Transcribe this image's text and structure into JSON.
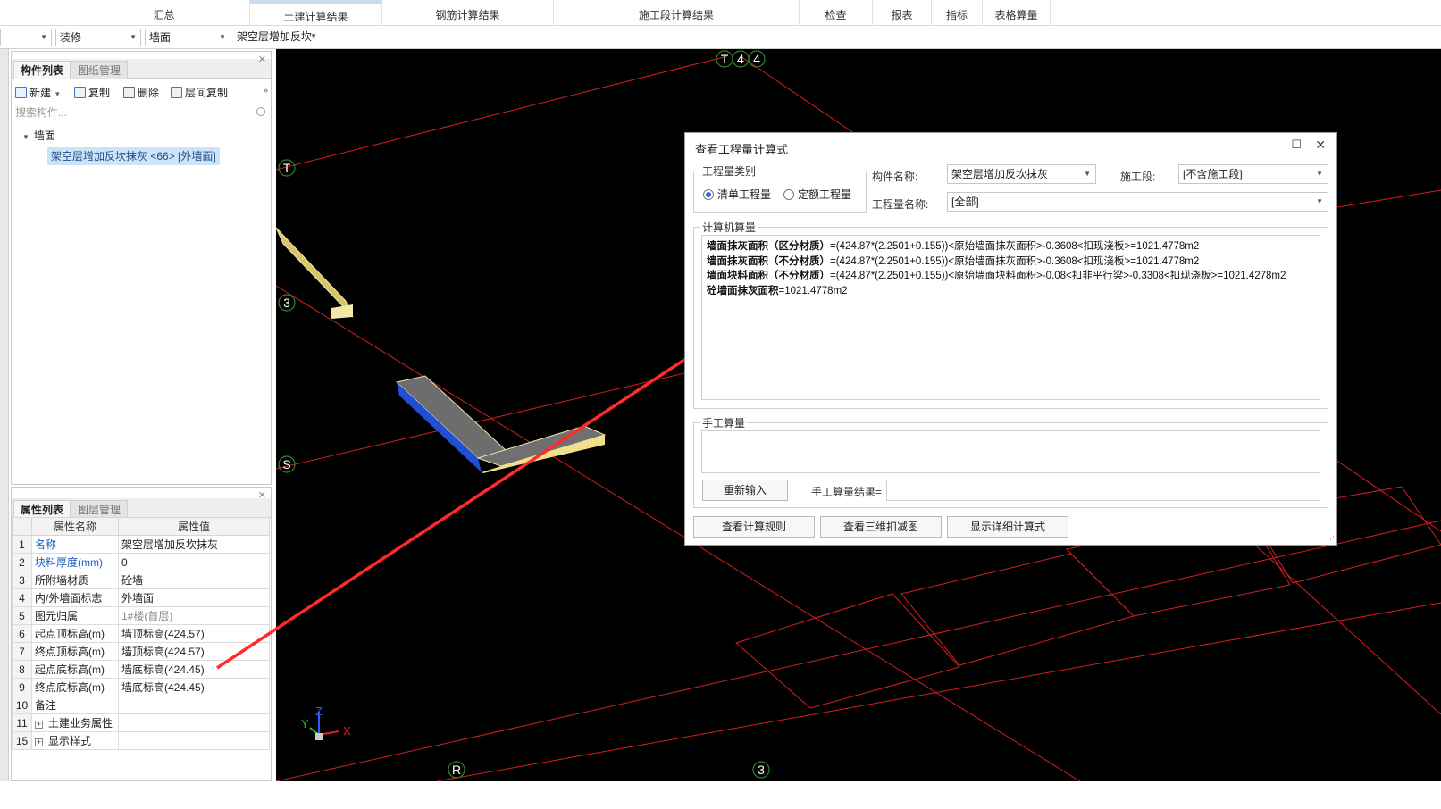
{
  "ribbon": {
    "tabs": [
      "汇总",
      "土建计算结果",
      "钢筋计算结果",
      "施工段计算结果",
      "检查",
      "报表",
      "指标",
      "表格算量"
    ]
  },
  "toolbar": {
    "combo_floor": "",
    "combo_category": "装修",
    "combo_type": "墙面",
    "combo_component": "架空层增加反坎"
  },
  "component_panel": {
    "tabs": [
      "构件列表",
      "图纸管理"
    ],
    "buttons": {
      "new": "新建",
      "copy": "复制",
      "delete": "删除",
      "floor_copy": "层间复制"
    },
    "search_placeholder": "搜索构件...",
    "tree_root": "墙面",
    "tree_item": "架空层增加反坎抹灰 <66> [外墙面]"
  },
  "property_panel": {
    "tabs": [
      "属性列表",
      "图层管理"
    ],
    "headers": {
      "name": "属性名称",
      "value": "属性值"
    },
    "rows": [
      {
        "num": "1",
        "name": "名称",
        "value": "架空层增加反坎抹灰"
      },
      {
        "num": "2",
        "name": "块料厚度(mm)",
        "value": "0"
      },
      {
        "num": "3",
        "name": "所附墙材质",
        "value": "砼墙"
      },
      {
        "num": "4",
        "name": "内/外墙面标志",
        "value": "外墙面"
      },
      {
        "num": "5",
        "name": "图元归属",
        "value": "1#楼(首层)"
      },
      {
        "num": "6",
        "name": "起点顶标高(m)",
        "value": "墙顶标高(424.57)"
      },
      {
        "num": "7",
        "name": "终点顶标高(m)",
        "value": "墙顶标高(424.57)"
      },
      {
        "num": "8",
        "name": "起点底标高(m)",
        "value": "墙底标高(424.45)"
      },
      {
        "num": "9",
        "name": "终点底标高(m)",
        "value": "墙底标高(424.45)"
      },
      {
        "num": "10",
        "name": "备注",
        "value": ""
      },
      {
        "num": "11",
        "name": "土建业务属性",
        "value": ""
      },
      {
        "num": "15",
        "name": "显示样式",
        "value": ""
      }
    ]
  },
  "viewport": {
    "axis_labels": {
      "t_top": "T",
      "four_a": "4",
      "four_b": "4",
      "t_left": "T",
      "three_left": "3",
      "s_left": "S",
      "r_bottom": "R",
      "three_bottom": "3"
    },
    "gizmo": {
      "x": "X",
      "y": "Y",
      "z": "Z"
    }
  },
  "dialog": {
    "title": "查看工程量计算式",
    "group_type": "工程量类别",
    "radio_list": "清单工程量",
    "radio_quota": "定额工程量",
    "component_name_label": "构件名称:",
    "component_name_value": "架空层增加反坎抹灰",
    "stage_label": "施工段:",
    "stage_value": "[不含施工段]",
    "quantity_name_label": "工程量名称:",
    "quantity_name_value": "[全部]",
    "computer_group": "计算机算量",
    "formulas": [
      {
        "label": "墙面抹灰面积（区分材质）",
        "expr": "=(424.87*(2.2501+0.155))<原始墙面抹灰面积>-0.3608<扣现浇板>=1021.4778m2"
      },
      {
        "label": "墙面抹灰面积（不分材质）",
        "expr": "=(424.87*(2.2501+0.155))<原始墙面抹灰面积>-0.3608<扣现浇板>=1021.4778m2"
      },
      {
        "label": "墙面块料面积（不分材质）",
        "expr": "=(424.87*(2.2501+0.155))<原始墙面块料面积>-0.08<扣非平行梁>-0.3308<扣现浇板>=1021.4278m2"
      },
      {
        "label": "砼墙面抹灰面积",
        "expr": "=1021.4778m2"
      }
    ],
    "manual_group": "手工算量",
    "reinput_button": "重新输入",
    "manual_result_label": "手工算量结果=",
    "btn_rules": "查看计算规则",
    "btn_3d": "查看三维扣减图",
    "btn_detail": "显示详细计算式"
  },
  "colors": {
    "viewport_bg": "#000000",
    "grid_line": "#e02020",
    "annotation_arrow": "#ff2a2a",
    "selection": "#cde3f7"
  }
}
